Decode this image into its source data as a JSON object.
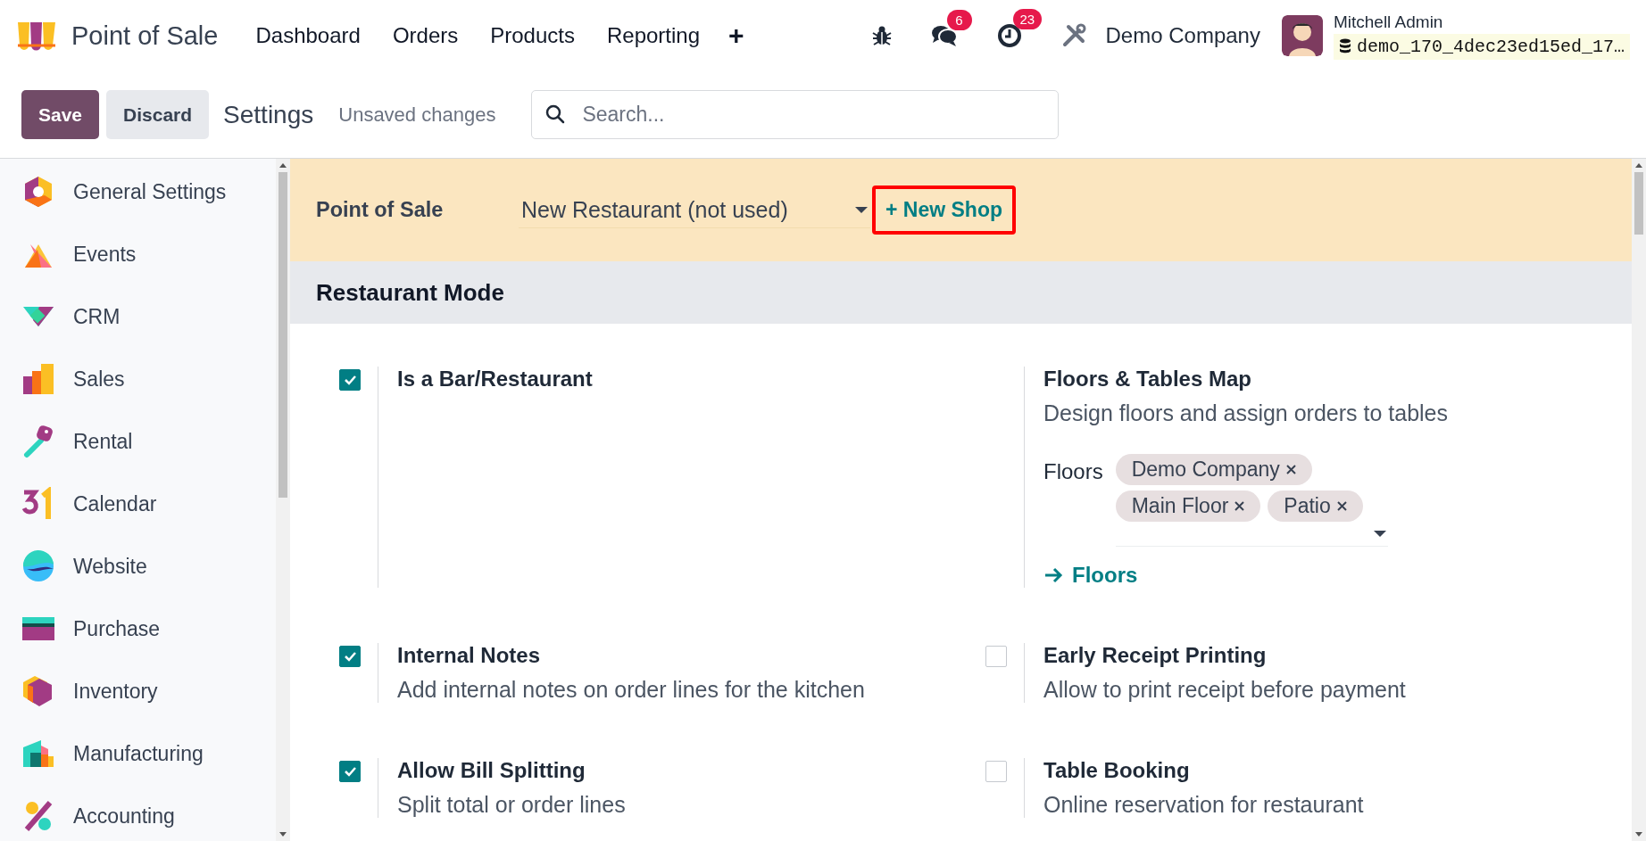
{
  "navbar": {
    "app_name": "Point of Sale",
    "menu": [
      "Dashboard",
      "Orders",
      "Products",
      "Reporting",
      "+"
    ],
    "messages_badge": "6",
    "activities_badge": "23",
    "company": "Demo Company",
    "user": "Mitchell Admin",
    "database": "demo_170_4dec23ed15ed_17…"
  },
  "control_panel": {
    "buttons": [
      {
        "label": "Save",
        "kind": "primary"
      },
      {
        "label": "Discard",
        "kind": "secondary"
      }
    ],
    "title": "Settings",
    "status": "Unsaved changes",
    "search": {
      "placeholder": "Search..."
    }
  },
  "sidebar": {
    "items": [
      {
        "label": "General Settings",
        "selected": false
      },
      {
        "label": "Events",
        "selected": false
      },
      {
        "label": "CRM",
        "selected": false
      },
      {
        "label": "Sales",
        "selected": false
      },
      {
        "label": "Rental",
        "selected": false
      },
      {
        "label": "Calendar",
        "selected": false
      },
      {
        "label": "Website",
        "selected": false
      },
      {
        "label": "Purchase",
        "selected": false
      },
      {
        "label": "Inventory",
        "selected": false
      },
      {
        "label": "Manufacturing",
        "selected": false
      },
      {
        "label": "Accounting",
        "selected": false
      }
    ]
  },
  "pos_bar": {
    "label": "Point of Sale",
    "shop": "New Restaurant (not used)",
    "new_shop": "+ New Shop",
    "highlighted": true
  },
  "section": {
    "title": "Restaurant Mode",
    "rows": [
      [
        {
          "kind": "checkbox",
          "checked": true,
          "title": "Is a Bar/Restaurant"
        },
        {
          "kind": "plain",
          "title": "Floors & Tables Map",
          "description": "Design floors and assign orders to tables",
          "floors": {
            "label": "Floors",
            "tags": [
              "Demo Company",
              "Main Floor",
              "Patio"
            ],
            "link": "Floors"
          }
        }
      ],
      [
        {
          "kind": "checkbox",
          "checked": true,
          "title": "Internal Notes",
          "description": "Add internal notes on order lines for the kitchen"
        },
        {
          "kind": "checkbox",
          "checked": false,
          "title": "Early Receipt Printing",
          "description": "Allow to print receipt before payment"
        }
      ],
      [
        {
          "kind": "checkbox",
          "checked": true,
          "title": "Allow Bill Splitting",
          "description": "Split total or order lines"
        },
        {
          "kind": "checkbox",
          "checked": false,
          "title": "Table Booking",
          "description": "Online reservation for restaurant"
        }
      ]
    ]
  }
}
